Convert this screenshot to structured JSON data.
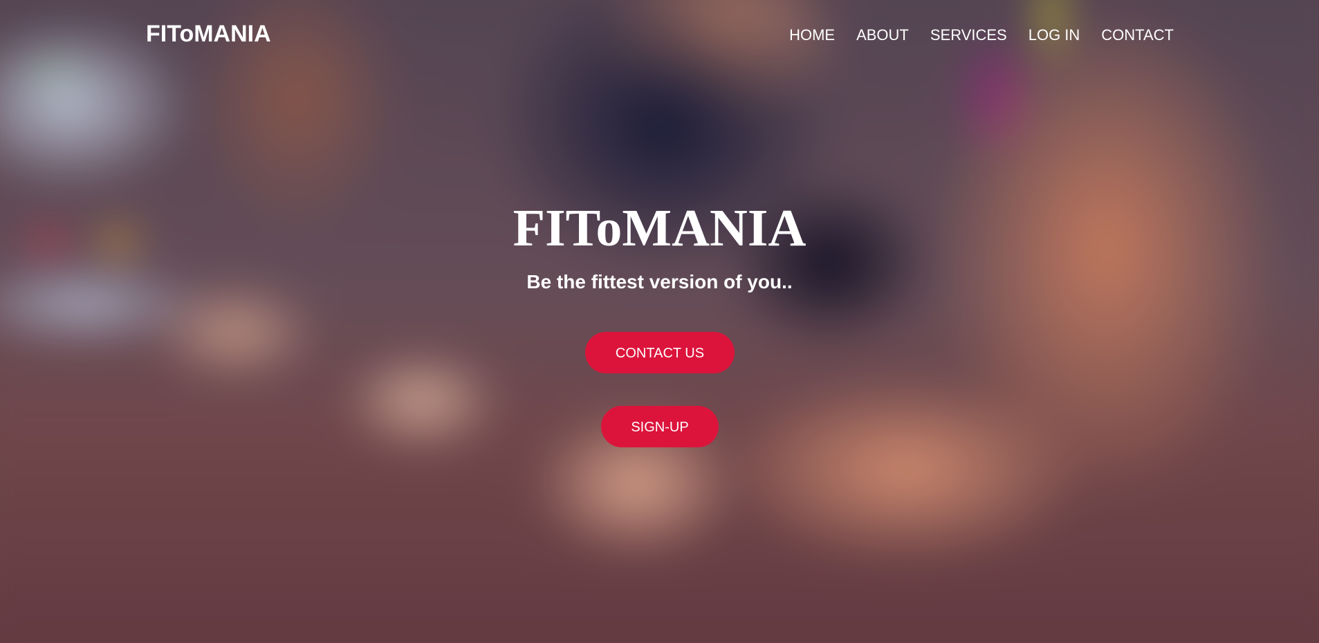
{
  "brand": {
    "logo": "FIToMANIA"
  },
  "nav": {
    "items": [
      {
        "label": "HOME"
      },
      {
        "label": "ABOUT"
      },
      {
        "label": "SERVICES"
      },
      {
        "label": "LOG IN"
      },
      {
        "label": "CONTACT"
      }
    ]
  },
  "hero": {
    "title": "FIToMANIA",
    "tagline": "Be the fittest version of you..",
    "contact_button": "CONTACT US",
    "signup_button": "SIGN-UP"
  },
  "colors": {
    "accent": "#dc143c",
    "text": "#ffffff"
  }
}
